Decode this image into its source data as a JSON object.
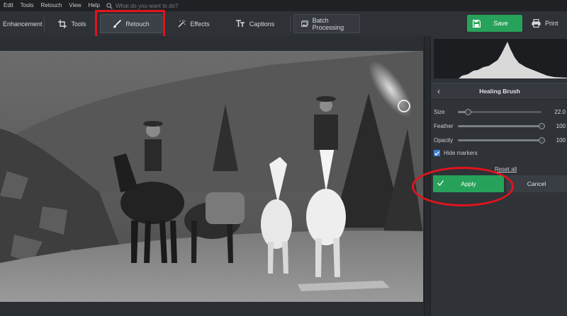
{
  "menu": {
    "items": [
      "Edit",
      "Tools",
      "Retouch",
      "View",
      "Help"
    ],
    "search_placeholder": "What do you want to do?"
  },
  "toolbar": {
    "enhancement": "Enhancement",
    "tools": "Tools",
    "retouch": "Retouch",
    "effects": "Effects",
    "captions": "Captions",
    "batch": "Batch Processing",
    "save": "Save",
    "print": "Print"
  },
  "panel": {
    "title": "Healing Brush",
    "sliders": [
      {
        "label": "Size",
        "value": "22.0",
        "level": 0.12
      },
      {
        "label": "Feather",
        "value": "100",
        "level": 1.0
      },
      {
        "label": "Opacity",
        "value": "100",
        "level": 1.0
      }
    ],
    "hide_markers": "Hide markers",
    "reset": "Reset all",
    "apply": "Apply",
    "cancel": "Cancel"
  },
  "colors": {
    "accent_green": "#27a25a",
    "highlight_red": "#e0141e",
    "checkbox_blue": "#3d7fd6"
  }
}
